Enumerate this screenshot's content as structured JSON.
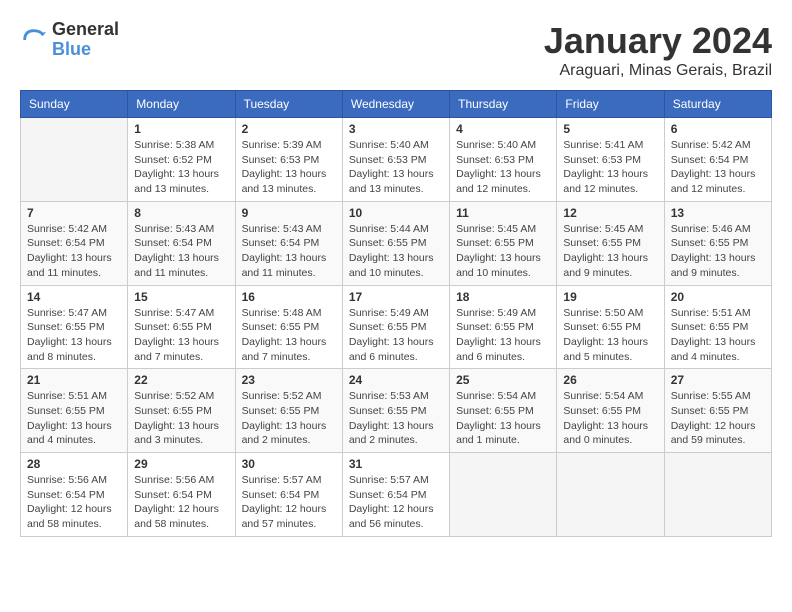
{
  "logo": {
    "text_general": "General",
    "text_blue": "Blue"
  },
  "title": "January 2024",
  "subtitle": "Araguari, Minas Gerais, Brazil",
  "weekdays": [
    "Sunday",
    "Monday",
    "Tuesday",
    "Wednesday",
    "Thursday",
    "Friday",
    "Saturday"
  ],
  "weeks": [
    [
      {
        "day": "",
        "info": ""
      },
      {
        "day": "1",
        "info": "Sunrise: 5:38 AM\nSunset: 6:52 PM\nDaylight: 13 hours\nand 13 minutes."
      },
      {
        "day": "2",
        "info": "Sunrise: 5:39 AM\nSunset: 6:53 PM\nDaylight: 13 hours\nand 13 minutes."
      },
      {
        "day": "3",
        "info": "Sunrise: 5:40 AM\nSunset: 6:53 PM\nDaylight: 13 hours\nand 13 minutes."
      },
      {
        "day": "4",
        "info": "Sunrise: 5:40 AM\nSunset: 6:53 PM\nDaylight: 13 hours\nand 12 minutes."
      },
      {
        "day": "5",
        "info": "Sunrise: 5:41 AM\nSunset: 6:53 PM\nDaylight: 13 hours\nand 12 minutes."
      },
      {
        "day": "6",
        "info": "Sunrise: 5:42 AM\nSunset: 6:54 PM\nDaylight: 13 hours\nand 12 minutes."
      }
    ],
    [
      {
        "day": "7",
        "info": "Sunrise: 5:42 AM\nSunset: 6:54 PM\nDaylight: 13 hours\nand 11 minutes."
      },
      {
        "day": "8",
        "info": "Sunrise: 5:43 AM\nSunset: 6:54 PM\nDaylight: 13 hours\nand 11 minutes."
      },
      {
        "day": "9",
        "info": "Sunrise: 5:43 AM\nSunset: 6:54 PM\nDaylight: 13 hours\nand 11 minutes."
      },
      {
        "day": "10",
        "info": "Sunrise: 5:44 AM\nSunset: 6:55 PM\nDaylight: 13 hours\nand 10 minutes."
      },
      {
        "day": "11",
        "info": "Sunrise: 5:45 AM\nSunset: 6:55 PM\nDaylight: 13 hours\nand 10 minutes."
      },
      {
        "day": "12",
        "info": "Sunrise: 5:45 AM\nSunset: 6:55 PM\nDaylight: 13 hours\nand 9 minutes."
      },
      {
        "day": "13",
        "info": "Sunrise: 5:46 AM\nSunset: 6:55 PM\nDaylight: 13 hours\nand 9 minutes."
      }
    ],
    [
      {
        "day": "14",
        "info": "Sunrise: 5:47 AM\nSunset: 6:55 PM\nDaylight: 13 hours\nand 8 minutes."
      },
      {
        "day": "15",
        "info": "Sunrise: 5:47 AM\nSunset: 6:55 PM\nDaylight: 13 hours\nand 7 minutes."
      },
      {
        "day": "16",
        "info": "Sunrise: 5:48 AM\nSunset: 6:55 PM\nDaylight: 13 hours\nand 7 minutes."
      },
      {
        "day": "17",
        "info": "Sunrise: 5:49 AM\nSunset: 6:55 PM\nDaylight: 13 hours\nand 6 minutes."
      },
      {
        "day": "18",
        "info": "Sunrise: 5:49 AM\nSunset: 6:55 PM\nDaylight: 13 hours\nand 6 minutes."
      },
      {
        "day": "19",
        "info": "Sunrise: 5:50 AM\nSunset: 6:55 PM\nDaylight: 13 hours\nand 5 minutes."
      },
      {
        "day": "20",
        "info": "Sunrise: 5:51 AM\nSunset: 6:55 PM\nDaylight: 13 hours\nand 4 minutes."
      }
    ],
    [
      {
        "day": "21",
        "info": "Sunrise: 5:51 AM\nSunset: 6:55 PM\nDaylight: 13 hours\nand 4 minutes."
      },
      {
        "day": "22",
        "info": "Sunrise: 5:52 AM\nSunset: 6:55 PM\nDaylight: 13 hours\nand 3 minutes."
      },
      {
        "day": "23",
        "info": "Sunrise: 5:52 AM\nSunset: 6:55 PM\nDaylight: 13 hours\nand 2 minutes."
      },
      {
        "day": "24",
        "info": "Sunrise: 5:53 AM\nSunset: 6:55 PM\nDaylight: 13 hours\nand 2 minutes."
      },
      {
        "day": "25",
        "info": "Sunrise: 5:54 AM\nSunset: 6:55 PM\nDaylight: 13 hours\nand 1 minute."
      },
      {
        "day": "26",
        "info": "Sunrise: 5:54 AM\nSunset: 6:55 PM\nDaylight: 13 hours\nand 0 minutes."
      },
      {
        "day": "27",
        "info": "Sunrise: 5:55 AM\nSunset: 6:55 PM\nDaylight: 12 hours\nand 59 minutes."
      }
    ],
    [
      {
        "day": "28",
        "info": "Sunrise: 5:56 AM\nSunset: 6:54 PM\nDaylight: 12 hours\nand 58 minutes."
      },
      {
        "day": "29",
        "info": "Sunrise: 5:56 AM\nSunset: 6:54 PM\nDaylight: 12 hours\nand 58 minutes."
      },
      {
        "day": "30",
        "info": "Sunrise: 5:57 AM\nSunset: 6:54 PM\nDaylight: 12 hours\nand 57 minutes."
      },
      {
        "day": "31",
        "info": "Sunrise: 5:57 AM\nSunset: 6:54 PM\nDaylight: 12 hours\nand 56 minutes."
      },
      {
        "day": "",
        "info": ""
      },
      {
        "day": "",
        "info": ""
      },
      {
        "day": "",
        "info": ""
      }
    ]
  ]
}
